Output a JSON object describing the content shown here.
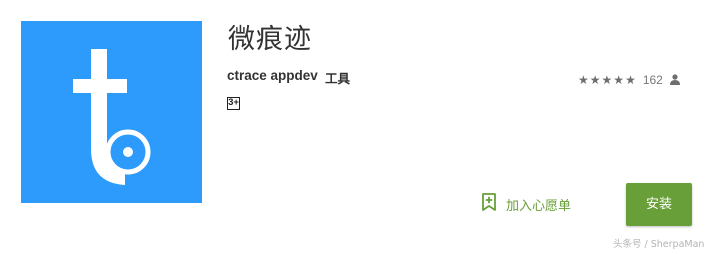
{
  "app": {
    "title": "微痕迹",
    "developer": "ctrace appdev",
    "category": "工具",
    "content_rating": "3+",
    "icon": "ctrace-t-logo",
    "icon_color": "#2d9bfb"
  },
  "rating": {
    "stars": 5,
    "count": "162",
    "star_color": "#6e6e6e",
    "icon": "person-icon"
  },
  "actions": {
    "wishlist_label": "加入心愿单",
    "wishlist_icon": "bookmark-plus-icon",
    "install_label": "安装",
    "accent_color": "#689f38"
  },
  "watermark": "头条号 / SherpaMan"
}
